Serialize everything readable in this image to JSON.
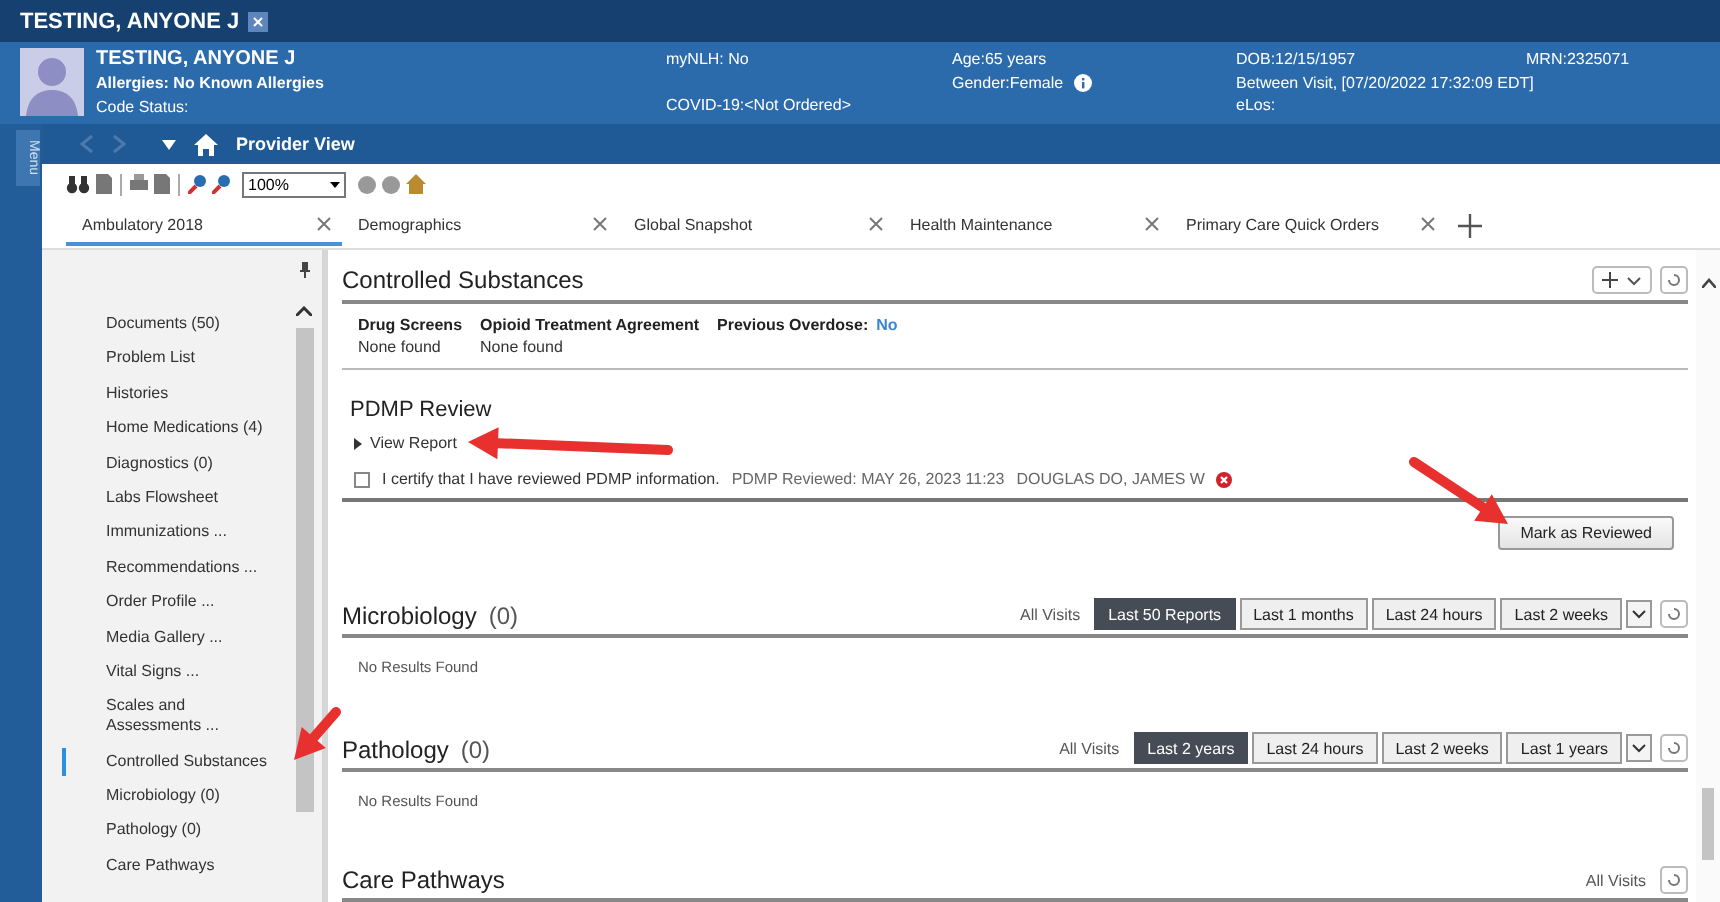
{
  "window": {
    "title": "TESTING, ANYONE J"
  },
  "patient": {
    "name": "TESTING, ANYONE J",
    "allergies": "Allergies: No Known Allergies",
    "code_status": "Code Status:",
    "mynlh": "myNLH: No",
    "covid": "COVID-19:<Not Ordered>",
    "age": "Age:65 years",
    "gender": "Gender:Female",
    "dob": "DOB:12/15/1957",
    "visit": "Between Visit, [07/20/2022 17:32:09 EDT]",
    "elos": "eLos:",
    "mrn": "MRN:2325071"
  },
  "menu_label": "Menu",
  "nav": {
    "title": "Provider View"
  },
  "toolbar": {
    "zoom": "100%"
  },
  "tabs": [
    {
      "label": "Ambulatory 2018",
      "selected": true
    },
    {
      "label": "Demographics",
      "selected": false
    },
    {
      "label": "Global Snapshot",
      "selected": false
    },
    {
      "label": "Health Maintenance",
      "selected": false
    },
    {
      "label": "Primary Care Quick Orders",
      "selected": false
    }
  ],
  "sidebar": {
    "items": [
      {
        "label": "Documents (50)",
        "selected": false
      },
      {
        "label": "Problem List",
        "selected": false
      },
      {
        "label": "Histories",
        "selected": false
      },
      {
        "label": "Home Medications (4)",
        "selected": false
      },
      {
        "label": "Diagnostics (0)",
        "selected": false
      },
      {
        "label": "Labs Flowsheet",
        "selected": false
      },
      {
        "label": "Immunizations ...",
        "selected": false
      },
      {
        "label": "Recommendations ...",
        "selected": false
      },
      {
        "label": "Order Profile ...",
        "selected": false
      },
      {
        "label": "Media Gallery ...",
        "selected": false
      },
      {
        "label": "Vital Signs ...",
        "selected": false
      },
      {
        "label": "Scales and Assessments ...",
        "selected": false
      },
      {
        "label": "Controlled Substances",
        "selected": true
      },
      {
        "label": "Microbiology (0)",
        "selected": false
      },
      {
        "label": "Pathology (0)",
        "selected": false
      },
      {
        "label": "Care Pathways",
        "selected": false
      }
    ]
  },
  "controlled_substances": {
    "title": "Controlled Substances",
    "fields": [
      {
        "kind": "stacked",
        "label": "Drug Screens",
        "value": "None found"
      },
      {
        "kind": "stacked",
        "label": "Opioid Treatment Agreement",
        "value": "None found"
      },
      {
        "kind": "inline",
        "label": "Previous Overdose:",
        "value": "No"
      }
    ]
  },
  "pdmp": {
    "title": "PDMP Review",
    "link": "View Report",
    "certify": {
      "label": "I certify that I have reviewed PDMP information.",
      "checked": false
    },
    "reviewed": "PDMP Reviewed: MAY 26, 2023 11:23",
    "reviewer": "DOUGLAS DO, JAMES W",
    "button": "Mark as Reviewed"
  },
  "result_sections": [
    {
      "title": "Microbiology",
      "count": "(0)",
      "scope": "All Visits",
      "filters": [
        {
          "label": "Last 50 Reports",
          "selected": true
        },
        {
          "label": "Last 1 months",
          "selected": false
        },
        {
          "label": "Last 24 hours",
          "selected": false
        },
        {
          "label": "Last 2 weeks",
          "selected": false
        }
      ],
      "message": "No Results Found"
    },
    {
      "title": "Pathology",
      "count": "(0)",
      "scope": "All Visits",
      "filters": [
        {
          "label": "Last 2 years",
          "selected": true
        },
        {
          "label": "Last 24 hours",
          "selected": false
        },
        {
          "label": "Last 2 weeks",
          "selected": false
        },
        {
          "label": "Last 1 years",
          "selected": false
        }
      ],
      "message": "No Results Found"
    },
    {
      "title": "Care Pathways",
      "scope": "All Visits"
    }
  ]
}
